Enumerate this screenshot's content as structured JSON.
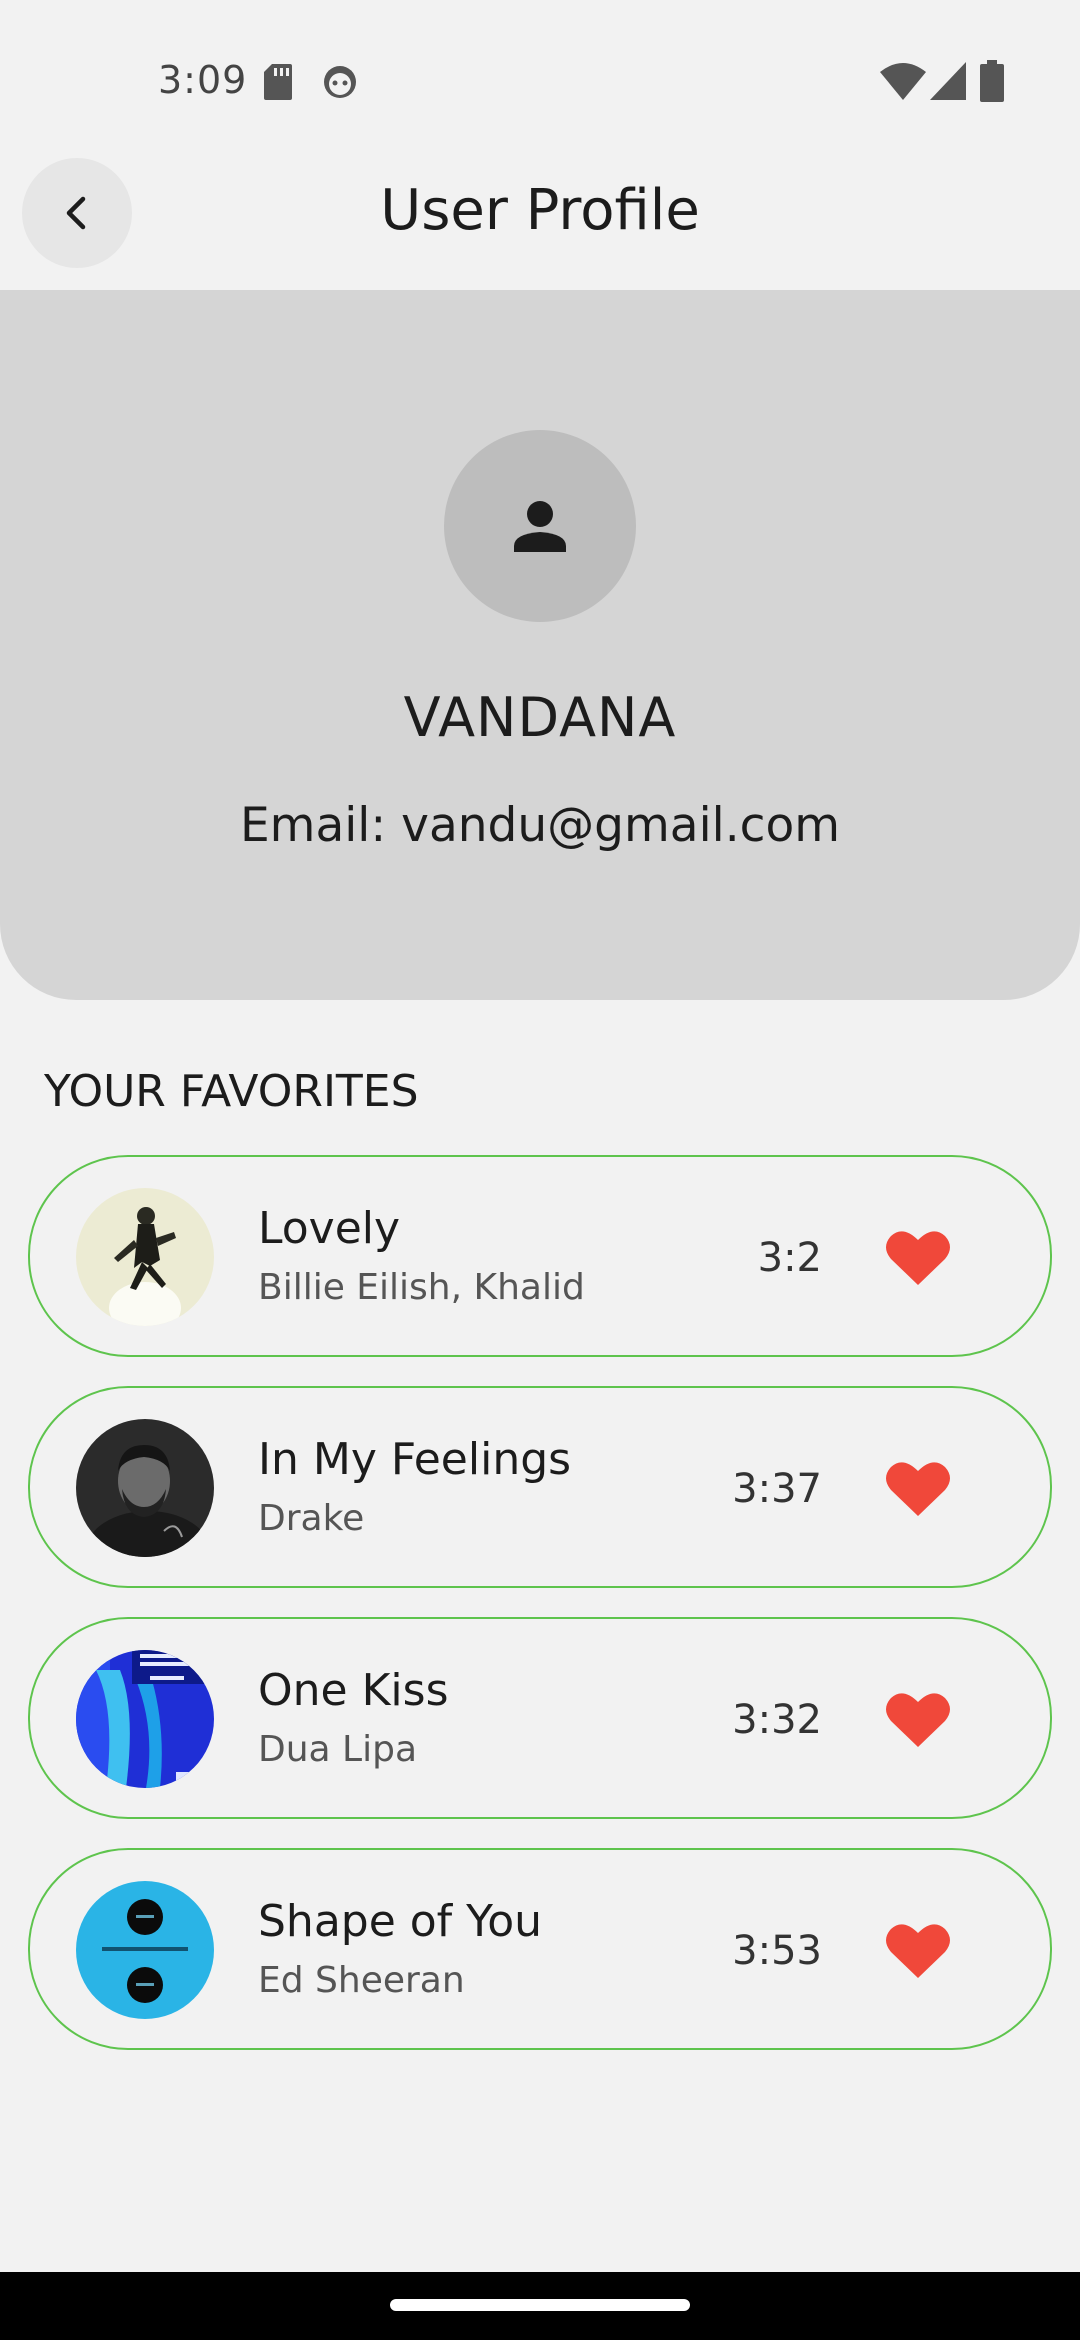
{
  "status_bar": {
    "time": "3:09"
  },
  "header": {
    "title": "User Profile"
  },
  "profile": {
    "name": "VANDANA",
    "email": "Email: vandu@gmail.com"
  },
  "favorites": {
    "title": "YOUR FAVORITES",
    "items": [
      {
        "title": "Lovely",
        "artist": "Billie Eilish, Khalid",
        "duration": "3:2"
      },
      {
        "title": "In My Feelings",
        "artist": "Drake",
        "duration": "3:37"
      },
      {
        "title": "One Kiss",
        "artist": "Dua Lipa",
        "duration": "3:32"
      },
      {
        "title": "Shape of You",
        "artist": "Ed Sheeran",
        "duration": "3:53"
      }
    ]
  },
  "colors": {
    "accent_border": "#5ec44d",
    "heart": "#f0483a",
    "profile_card": "#d5d5d5"
  },
  "icons": [
    "back-arrow-icon",
    "person-icon",
    "heart-icon",
    "wifi-icon",
    "signal-icon",
    "battery-icon",
    "sd-card-icon"
  ]
}
